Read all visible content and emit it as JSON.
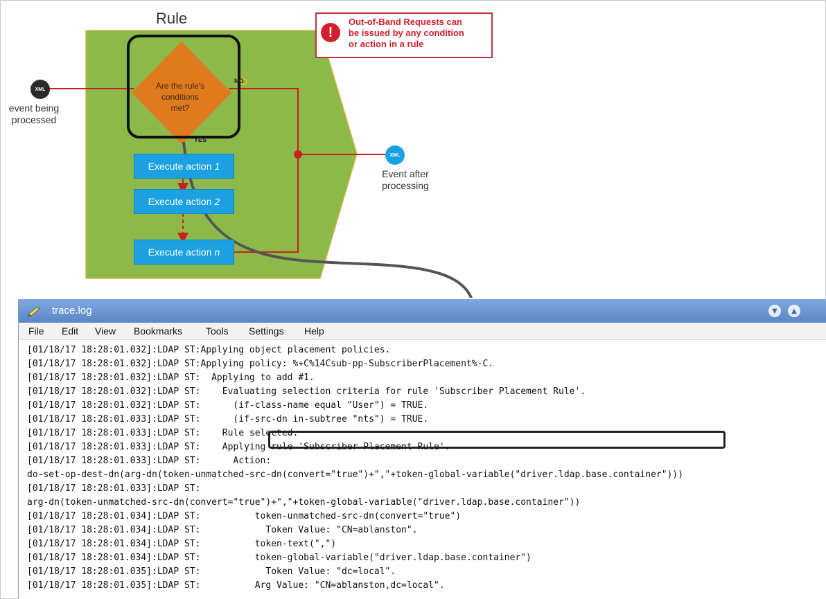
{
  "diagram": {
    "title": "Rule",
    "input_event_label_line1": "event being",
    "input_event_label_line2": "processed",
    "output_event_label_line1": "Event after",
    "output_event_label_line2": "processing",
    "xml_badge": "XML",
    "condition_line1": "Are the rule's",
    "condition_line2": "conditions",
    "condition_line3": "met?",
    "no_label": "NO",
    "yes_label": "YES",
    "actions": [
      {
        "prefix": "Execute action",
        "suffix": "1"
      },
      {
        "prefix": "Execute action",
        "suffix": "2"
      },
      {
        "prefix": "Execute action",
        "suffix": "n"
      }
    ],
    "note_icon": "exclamation-icon",
    "note_line1": "Out-of-Band Requests can",
    "note_line2": "be issued by any condition",
    "note_line3": "or action in a rule",
    "colors": {
      "rule_background": "#8db84a",
      "diamond": "#e07a1f",
      "action_box": "#1ba0e2",
      "flow_line": "#cc1f1f",
      "note_text": "#d21f2b"
    }
  },
  "window": {
    "title": "trace.log",
    "menu": [
      "File",
      "Edit",
      "View",
      "Bookmarks",
      "Tools",
      "Settings",
      "Help"
    ],
    "log_lines": [
      "[01/18/17 18:28:01.032]:LDAP ST:Applying object placement policies.",
      "[01/18/17 18:28:01.032]:LDAP ST:Applying policy: %+C%14Csub-pp-SubscriberPlacement%-C.",
      "[01/18/17 18:28:01.032]:LDAP ST:  Applying to add #1.",
      "[01/18/17 18:28:01.032]:LDAP ST:    Evaluating selection criteria for rule 'Subscriber Placement Rule'.",
      "[01/18/17 18:28:01.032]:LDAP ST:      (if-class-name equal \"User\") = TRUE.",
      "[01/18/17 18:28:01.033]:LDAP ST:      (if-src-dn in-subtree \"nts\") = TRUE.",
      "[01/18/17 18:28:01.033]:LDAP ST:    Rule selected.",
      "[01/18/17 18:28:01.033]:LDAP ST:    Applying rule 'Subscriber Placement Rule'.",
      "[01/18/17 18:28:01.033]:LDAP ST:      Action:",
      "do-set-op-dest-dn(arg-dn(token-unmatched-src-dn(convert=\"true\")+\",\"+token-global-variable(\"driver.ldap.base.container\")))",
      "[01/18/17 18:28:01.033]:LDAP ST:",
      "arg-dn(token-unmatched-src-dn(convert=\"true\")+\",\"+token-global-variable(\"driver.ldap.base.container\"))",
      "[01/18/17 18:28:01.034]:LDAP ST:          token-unmatched-src-dn(convert=\"true\")",
      "[01/18/17 18:28:01.034]:LDAP ST:            Token Value: \"CN=ablanston\".",
      "[01/18/17 18:28:01.034]:LDAP ST:          token-text(\",\")",
      "[01/18/17 18:28:01.034]:LDAP ST:          token-global-variable(\"driver.ldap.base.container\")",
      "[01/18/17 18:28:01.035]:LDAP ST:            Token Value: \"dc=local\".",
      "[01/18/17 18:28:01.035]:LDAP ST:          Arg Value: \"CN=ablanston,dc=local\"."
    ]
  }
}
